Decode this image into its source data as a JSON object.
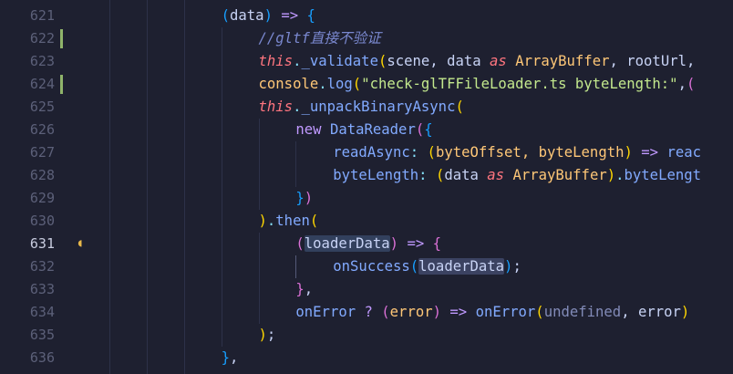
{
  "lines": [
    {
      "num": "621",
      "tokens": [
        {
          "t": "(",
          "c": "b3"
        },
        {
          "t": "data",
          "c": "plain"
        },
        {
          "t": ") ",
          "c": "b3"
        },
        {
          "t": "=>",
          "c": "kw"
        },
        {
          "t": " ",
          "c": "plain"
        },
        {
          "t": "{",
          "c": "b3"
        }
      ]
    },
    {
      "num": "622",
      "tokens": [
        {
          "t": "//gltf直接不验证",
          "c": "comment"
        }
      ]
    },
    {
      "num": "623",
      "tokens": [
        {
          "t": "this",
          "c": "this"
        },
        {
          "t": ".",
          "c": "op"
        },
        {
          "t": "_validate",
          "c": "fn"
        },
        {
          "t": "(",
          "c": "b1"
        },
        {
          "t": "scene, data ",
          "c": "plain"
        },
        {
          "t": "as",
          "c": "this"
        },
        {
          "t": " ",
          "c": "plain"
        },
        {
          "t": "ArrayBuffer",
          "c": "type"
        },
        {
          "t": ", rootUrl,",
          "c": "plain"
        }
      ]
    },
    {
      "num": "624",
      "tokens": [
        {
          "t": "console",
          "c": "type"
        },
        {
          "t": ".",
          "c": "op"
        },
        {
          "t": "log",
          "c": "fn"
        },
        {
          "t": "(",
          "c": "b1"
        },
        {
          "t": "\"check-glTFFileLoader.ts byteLength:\"",
          "c": "str"
        },
        {
          "t": ",",
          "c": "plain"
        },
        {
          "t": "(",
          "c": "b2"
        }
      ]
    },
    {
      "num": "625",
      "tokens": [
        {
          "t": "this",
          "c": "this"
        },
        {
          "t": ".",
          "c": "op"
        },
        {
          "t": "_unpackBinaryAsync",
          "c": "fn"
        },
        {
          "t": "(",
          "c": "b1"
        }
      ]
    },
    {
      "num": "626",
      "tokens": [
        {
          "t": "new",
          "c": "kw"
        },
        {
          "t": " ",
          "c": "plain"
        },
        {
          "t": "DataReader",
          "c": "fn"
        },
        {
          "t": "(",
          "c": "b2"
        },
        {
          "t": "{",
          "c": "b3"
        }
      ]
    },
    {
      "num": "627",
      "tokens": [
        {
          "t": "readAsync",
          "c": "fn"
        },
        {
          "t": ": ",
          "c": "op"
        },
        {
          "t": "(",
          "c": "b1"
        },
        {
          "t": "byteOffset, byteLength",
          "c": "type"
        },
        {
          "t": ")",
          "c": "b1"
        },
        {
          "t": " => ",
          "c": "kw"
        },
        {
          "t": "reac",
          "c": "fn"
        }
      ]
    },
    {
      "num": "628",
      "tokens": [
        {
          "t": "byteLength",
          "c": "fn"
        },
        {
          "t": ": ",
          "c": "op"
        },
        {
          "t": "(",
          "c": "b1"
        },
        {
          "t": "data ",
          "c": "plain"
        },
        {
          "t": "as",
          "c": "this"
        },
        {
          "t": " ",
          "c": "plain"
        },
        {
          "t": "ArrayBuffer",
          "c": "type"
        },
        {
          "t": ")",
          "c": "b1"
        },
        {
          "t": ".",
          "c": "op"
        },
        {
          "t": "byteLengt",
          "c": "fn"
        }
      ]
    },
    {
      "num": "629",
      "tokens": [
        {
          "t": "}",
          "c": "b3"
        },
        {
          "t": ")",
          "c": "b2"
        }
      ]
    },
    {
      "num": "630",
      "tokens": [
        {
          "t": ")",
          "c": "b1"
        },
        {
          "t": ".",
          "c": "op"
        },
        {
          "t": "then",
          "c": "fn"
        },
        {
          "t": "(",
          "c": "b1"
        }
      ]
    },
    {
      "num": "631",
      "tokens": [
        {
          "t": "(",
          "c": "b2"
        },
        {
          "t": "loaderData",
          "c": "hl"
        },
        {
          "t": ")",
          "c": "b2"
        },
        {
          "t": " => ",
          "c": "kw"
        },
        {
          "t": "{",
          "c": "b2"
        }
      ]
    },
    {
      "num": "632",
      "tokens": [
        {
          "t": "onSuccess",
          "c": "fn"
        },
        {
          "t": "(",
          "c": "b3"
        },
        {
          "t": "loaderData",
          "c": "hl2"
        },
        {
          "t": ")",
          "c": "b3"
        },
        {
          "t": ";",
          "c": "plain"
        }
      ]
    },
    {
      "num": "633",
      "tokens": [
        {
          "t": "}",
          "c": "b2"
        },
        {
          "t": ",",
          "c": "plain"
        }
      ]
    },
    {
      "num": "634",
      "tokens": [
        {
          "t": "onError",
          "c": "fn"
        },
        {
          "t": " ? ",
          "c": "kw"
        },
        {
          "t": "(",
          "c": "b2"
        },
        {
          "t": "error",
          "c": "type"
        },
        {
          "t": ")",
          "c": "b2"
        },
        {
          "t": " => ",
          "c": "kw"
        },
        {
          "t": "onError",
          "c": "fn"
        },
        {
          "t": "(",
          "c": "b1"
        },
        {
          "t": "undefined",
          "c": "muted"
        },
        {
          "t": ", error",
          "c": "plain"
        },
        {
          "t": ")",
          "c": "b1"
        }
      ]
    },
    {
      "num": "635",
      "tokens": [
        {
          "t": ")",
          "c": "b1"
        },
        {
          "t": ";",
          "c": "plain"
        }
      ]
    },
    {
      "num": "636",
      "tokens": [
        {
          "t": "}",
          "c": "b3"
        },
        {
          "t": ",",
          "c": "plain"
        }
      ]
    }
  ],
  "active_line": "631",
  "modified_lines": [
    "622",
    "624"
  ],
  "lightbulb_line": "631",
  "colors": {
    "background": "#1e2030",
    "line_number": "#5c6079",
    "git_modified": "#8fb36a",
    "lightbulb": "#e8b84a"
  }
}
